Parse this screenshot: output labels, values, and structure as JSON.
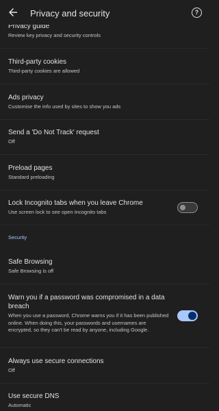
{
  "header": {
    "title": "Privacy and security",
    "back_icon": "arrow-back-icon",
    "help_icon": "help-icon"
  },
  "items": {
    "privacy_guide": {
      "title": "Privacy guide",
      "sub": "Review key privacy and security controls"
    },
    "third_party_cookies": {
      "title": "Third-party cookies",
      "sub": "Third-party cookies are allowed"
    },
    "ads_privacy": {
      "title": "Ads privacy",
      "sub": "Customise the info used by sites to show you ads"
    },
    "do_not_track": {
      "title": "Send a 'Do Not Track' request",
      "sub": "Off"
    },
    "preload_pages": {
      "title": "Preload pages",
      "sub": "Standard preloading"
    },
    "lock_incognito": {
      "title": "Lock Incognito tabs when you leave Chrome",
      "sub": "Use screen lock to see open Incognito tabs",
      "enabled": false
    },
    "safe_browsing": {
      "title": "Safe Browsing",
      "sub": "Safe Browsing is off"
    },
    "password_breach": {
      "title": "Warn you if a password was compromised in a data breach",
      "sub": "When you use a password, Chrome warns you if it has been published online. When doing this, your passwords and usernames are encrypted, so they can't be read by anyone, including Google.",
      "enabled": true
    },
    "secure_connections": {
      "title": "Always use secure connections",
      "sub": "Off"
    },
    "secure_dns": {
      "title": "Use secure DNS",
      "sub": "Automatic"
    }
  },
  "sections": {
    "security": "Security"
  },
  "colors": {
    "accent": "#a8c7fa",
    "background": "#1f1f1f"
  }
}
